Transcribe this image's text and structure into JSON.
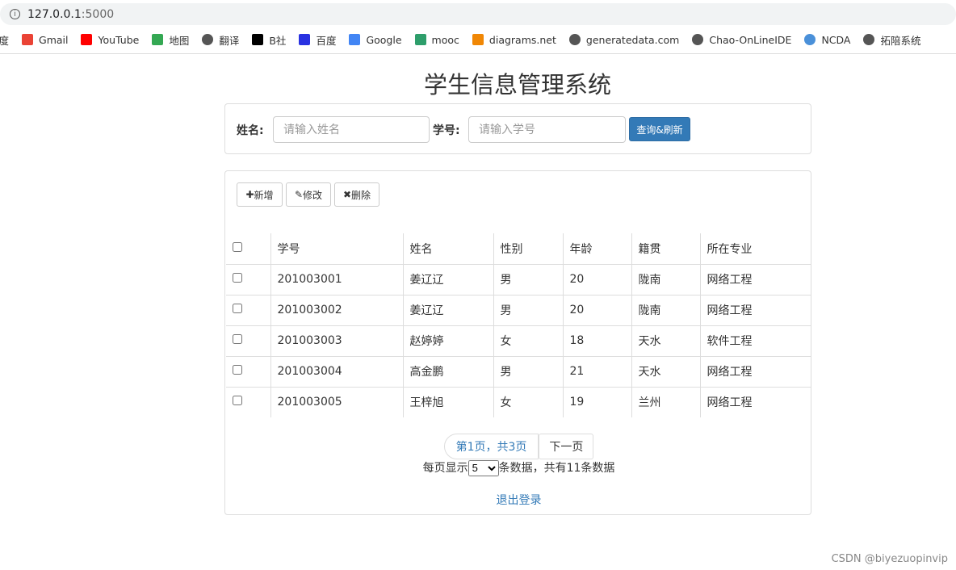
{
  "browser": {
    "url_host": "127.0.0.1",
    "url_port": ":5000",
    "bookmarks": [
      {
        "label": "百度",
        "icon": "baidu-icon",
        "color": "#fff"
      },
      {
        "label": "Gmail",
        "icon": "gmail-icon",
        "color": "#ea4335"
      },
      {
        "label": "YouTube",
        "icon": "youtube-icon",
        "color": "#ff0000"
      },
      {
        "label": "地图",
        "icon": "maps-icon",
        "color": "#34a853"
      },
      {
        "label": "翻译",
        "icon": "globe-icon",
        "color": "#555555"
      },
      {
        "label": "B社",
        "icon": "b-icon",
        "color": "#000000"
      },
      {
        "label": "百度",
        "icon": "baidu-paw-icon",
        "color": "#2932e1"
      },
      {
        "label": "Google",
        "icon": "google-icon",
        "color": "#4285f4"
      },
      {
        "label": "mooc",
        "icon": "mooc-icon",
        "color": "#2e9e6b"
      },
      {
        "label": "diagrams.net",
        "icon": "diagrams-icon",
        "color": "#f08705"
      },
      {
        "label": "generatedata.com",
        "icon": "globe-icon",
        "color": "#555555"
      },
      {
        "label": "Chao-OnLineIDE",
        "icon": "globe-icon",
        "color": "#555555"
      },
      {
        "label": "NCDA",
        "icon": "ncda-icon",
        "color": "#4a90d9"
      },
      {
        "label": "拓陪系统",
        "icon": "globe-icon",
        "color": "#555555"
      }
    ]
  },
  "title": "学生信息管理系统",
  "search": {
    "name_label": "姓名:",
    "name_placeholder": "请输入姓名",
    "id_label": "学号:",
    "id_placeholder": "请输入学号",
    "query_button": "查询&刷新"
  },
  "toolbar": {
    "add": "新增",
    "edit": "修改",
    "delete": "删除"
  },
  "table": {
    "headers": [
      "学号",
      "姓名",
      "性别",
      "年龄",
      "籍贯",
      "所在专业"
    ],
    "rows": [
      [
        "201003001",
        "姜辽辽",
        "男",
        "20",
        "陇南",
        "网络工程"
      ],
      [
        "201003002",
        "姜辽辽",
        "男",
        "20",
        "陇南",
        "网络工程"
      ],
      [
        "201003003",
        "赵婷婷",
        "女",
        "18",
        "天水",
        "软件工程"
      ],
      [
        "201003004",
        "高金鹏",
        "男",
        "21",
        "天水",
        "网络工程"
      ],
      [
        "201003005",
        "王梓旭",
        "女",
        "19",
        "兰州",
        "网络工程"
      ]
    ]
  },
  "pagination": {
    "current": "第1页，共3页",
    "next": "下一页",
    "per_page_prefix": "每页显示",
    "per_page_value": "5",
    "per_page_suffix": "条数据，共有11条数据"
  },
  "logout": "退出登录",
  "watermark": "CSDN @biyezuopinvip",
  "accent": "#337ab7"
}
